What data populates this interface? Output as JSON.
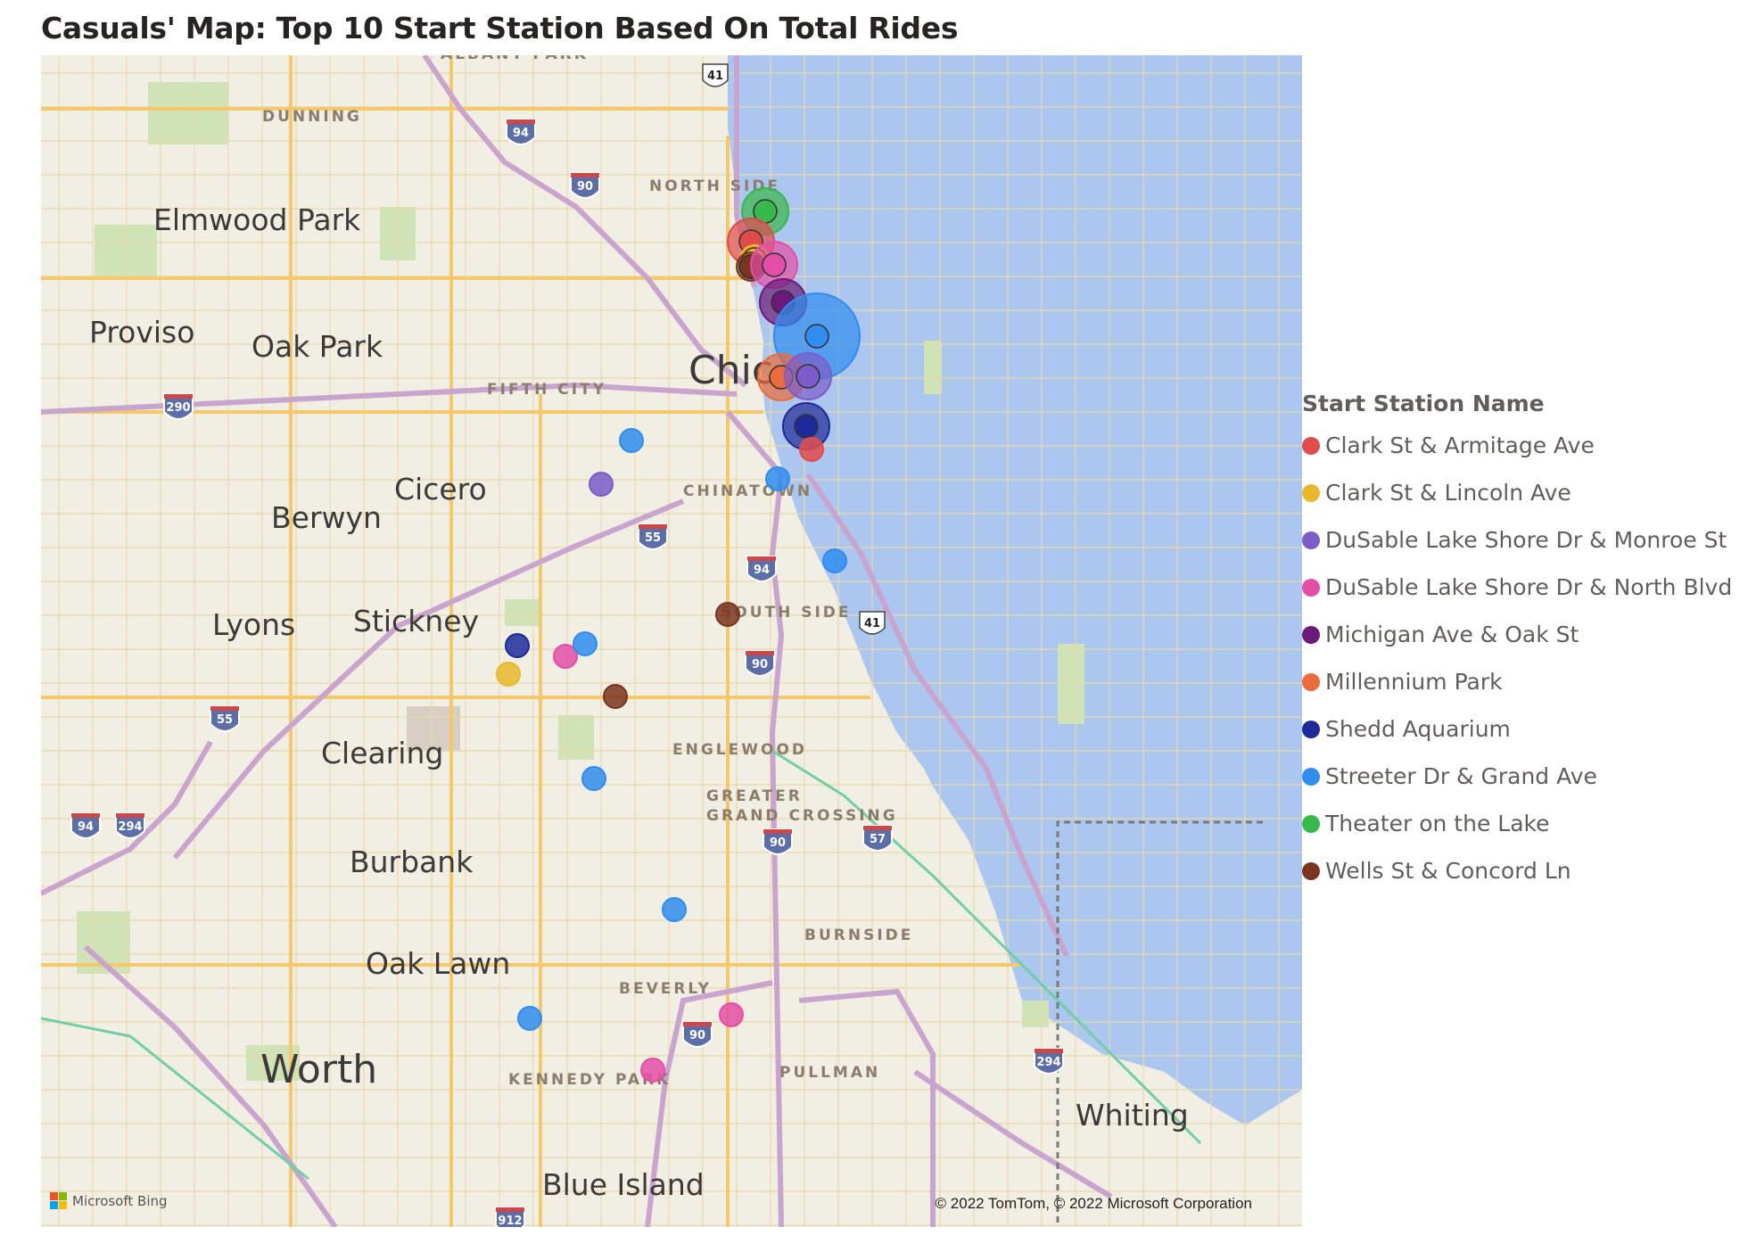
{
  "title": "Casuals' Map: Top 10 Start Station Based On Total Rides",
  "legend": {
    "title": "Start Station Name",
    "items": [
      {
        "label": "Clark St & Armitage Ave",
        "color": "#e04b4b"
      },
      {
        "label": "Clark St & Lincoln Ave",
        "color": "#e8b92a"
      },
      {
        "label": "DuSable Lake Shore Dr & Monroe St",
        "color": "#7b5cc9"
      },
      {
        "label": "DuSable Lake Shore Dr & North Blvd",
        "color": "#e54ea7"
      },
      {
        "label": "Michigan Ave & Oak St",
        "color": "#6b1a7a"
      },
      {
        "label": "Millennium Park",
        "color": "#eb6c3a"
      },
      {
        "label": "Shedd Aquarium",
        "color": "#1f2a9a"
      },
      {
        "label": "Streeter Dr & Grand Ave",
        "color": "#2f8df0"
      },
      {
        "label": "Theater on the Lake",
        "color": "#36b84a"
      },
      {
        "label": "Wells St & Concord Ln",
        "color": "#7a3520"
      }
    ]
  },
  "map": {
    "provider": "Microsoft Bing",
    "copyright": "© 2022 TomTom, © 2022 Microsoft Corporation",
    "places": [
      {
        "name": "Elmwood Park",
        "size": "big"
      },
      {
        "name": "Proviso",
        "size": "big"
      },
      {
        "name": "Oak Park",
        "size": "big"
      },
      {
        "name": "Chic",
        "size": "huge"
      },
      {
        "name": "Cicero",
        "size": "big"
      },
      {
        "name": "Berwyn",
        "size": "big"
      },
      {
        "name": "Lyons",
        "size": "big"
      },
      {
        "name": "Stickney",
        "size": "big"
      },
      {
        "name": "Clearing",
        "size": "big"
      },
      {
        "name": "Burbank",
        "size": "big"
      },
      {
        "name": "Oak Lawn",
        "size": "big"
      },
      {
        "name": "Worth",
        "size": "huge"
      },
      {
        "name": "Blue Island",
        "size": "big"
      },
      {
        "name": "Whiting",
        "size": "big"
      }
    ],
    "districts": [
      "ALBANY PARK",
      "DUNNING",
      "NORTH SIDE",
      "FIFTH CITY",
      "CHINATOWN",
      "SOUTH SIDE",
      "ENGLEWOOD",
      "GREATER",
      "GRAND CROSSING",
      "BURNSIDE",
      "BEVERLY",
      "KENNEDY PARK",
      "PULLMAN"
    ],
    "shields": [
      "94",
      "90",
      "290",
      "55",
      "94",
      "90",
      "55",
      "294",
      "94",
      "90",
      "57",
      "90",
      "294",
      "912"
    ],
    "us_routes": [
      "41",
      "41"
    ],
    "points": [
      {
        "station": "Theater on the Lake",
        "size": "large"
      },
      {
        "station": "Clark St & Armitage Ave",
        "size": "large"
      },
      {
        "station": "Clark St & Lincoln Ave",
        "size": "medium"
      },
      {
        "station": "Wells St & Concord Ln",
        "size": "medium"
      },
      {
        "station": "DuSable Lake Shore Dr & North Blvd",
        "size": "large"
      },
      {
        "station": "Michigan Ave & Oak St",
        "size": "large"
      },
      {
        "station": "Streeter Dr & Grand Ave",
        "size": "largest"
      },
      {
        "station": "Millennium Park",
        "size": "large"
      },
      {
        "station": "DuSable Lake Shore Dr & Monroe St",
        "size": "large"
      },
      {
        "station": "Shedd Aquarium",
        "size": "large"
      },
      {
        "station": "Clark St & Armitage Ave",
        "size": "small"
      },
      {
        "station": "Streeter Dr & Grand Ave",
        "size": "small"
      },
      {
        "station": "DuSable Lake Shore Dr & Monroe St",
        "size": "small"
      },
      {
        "station": "Streeter Dr & Grand Ave",
        "size": "small"
      },
      {
        "station": "Streeter Dr & Grand Ave",
        "size": "small"
      },
      {
        "station": "Wells St & Concord Ln",
        "size": "small"
      },
      {
        "station": "Shedd Aquarium",
        "size": "small"
      },
      {
        "station": "DuSable Lake Shore Dr & North Blvd",
        "size": "small"
      },
      {
        "station": "Streeter Dr & Grand Ave",
        "size": "small"
      },
      {
        "station": "Clark St & Lincoln Ave",
        "size": "small"
      },
      {
        "station": "Wells St & Concord Ln",
        "size": "small"
      },
      {
        "station": "Streeter Dr & Grand Ave",
        "size": "small"
      },
      {
        "station": "Streeter Dr & Grand Ave",
        "size": "small"
      },
      {
        "station": "Streeter Dr & Grand Ave",
        "size": "small"
      },
      {
        "station": "DuSable Lake Shore Dr & North Blvd",
        "size": "small"
      },
      {
        "station": "DuSable Lake Shore Dr & North Blvd",
        "size": "small"
      }
    ]
  }
}
